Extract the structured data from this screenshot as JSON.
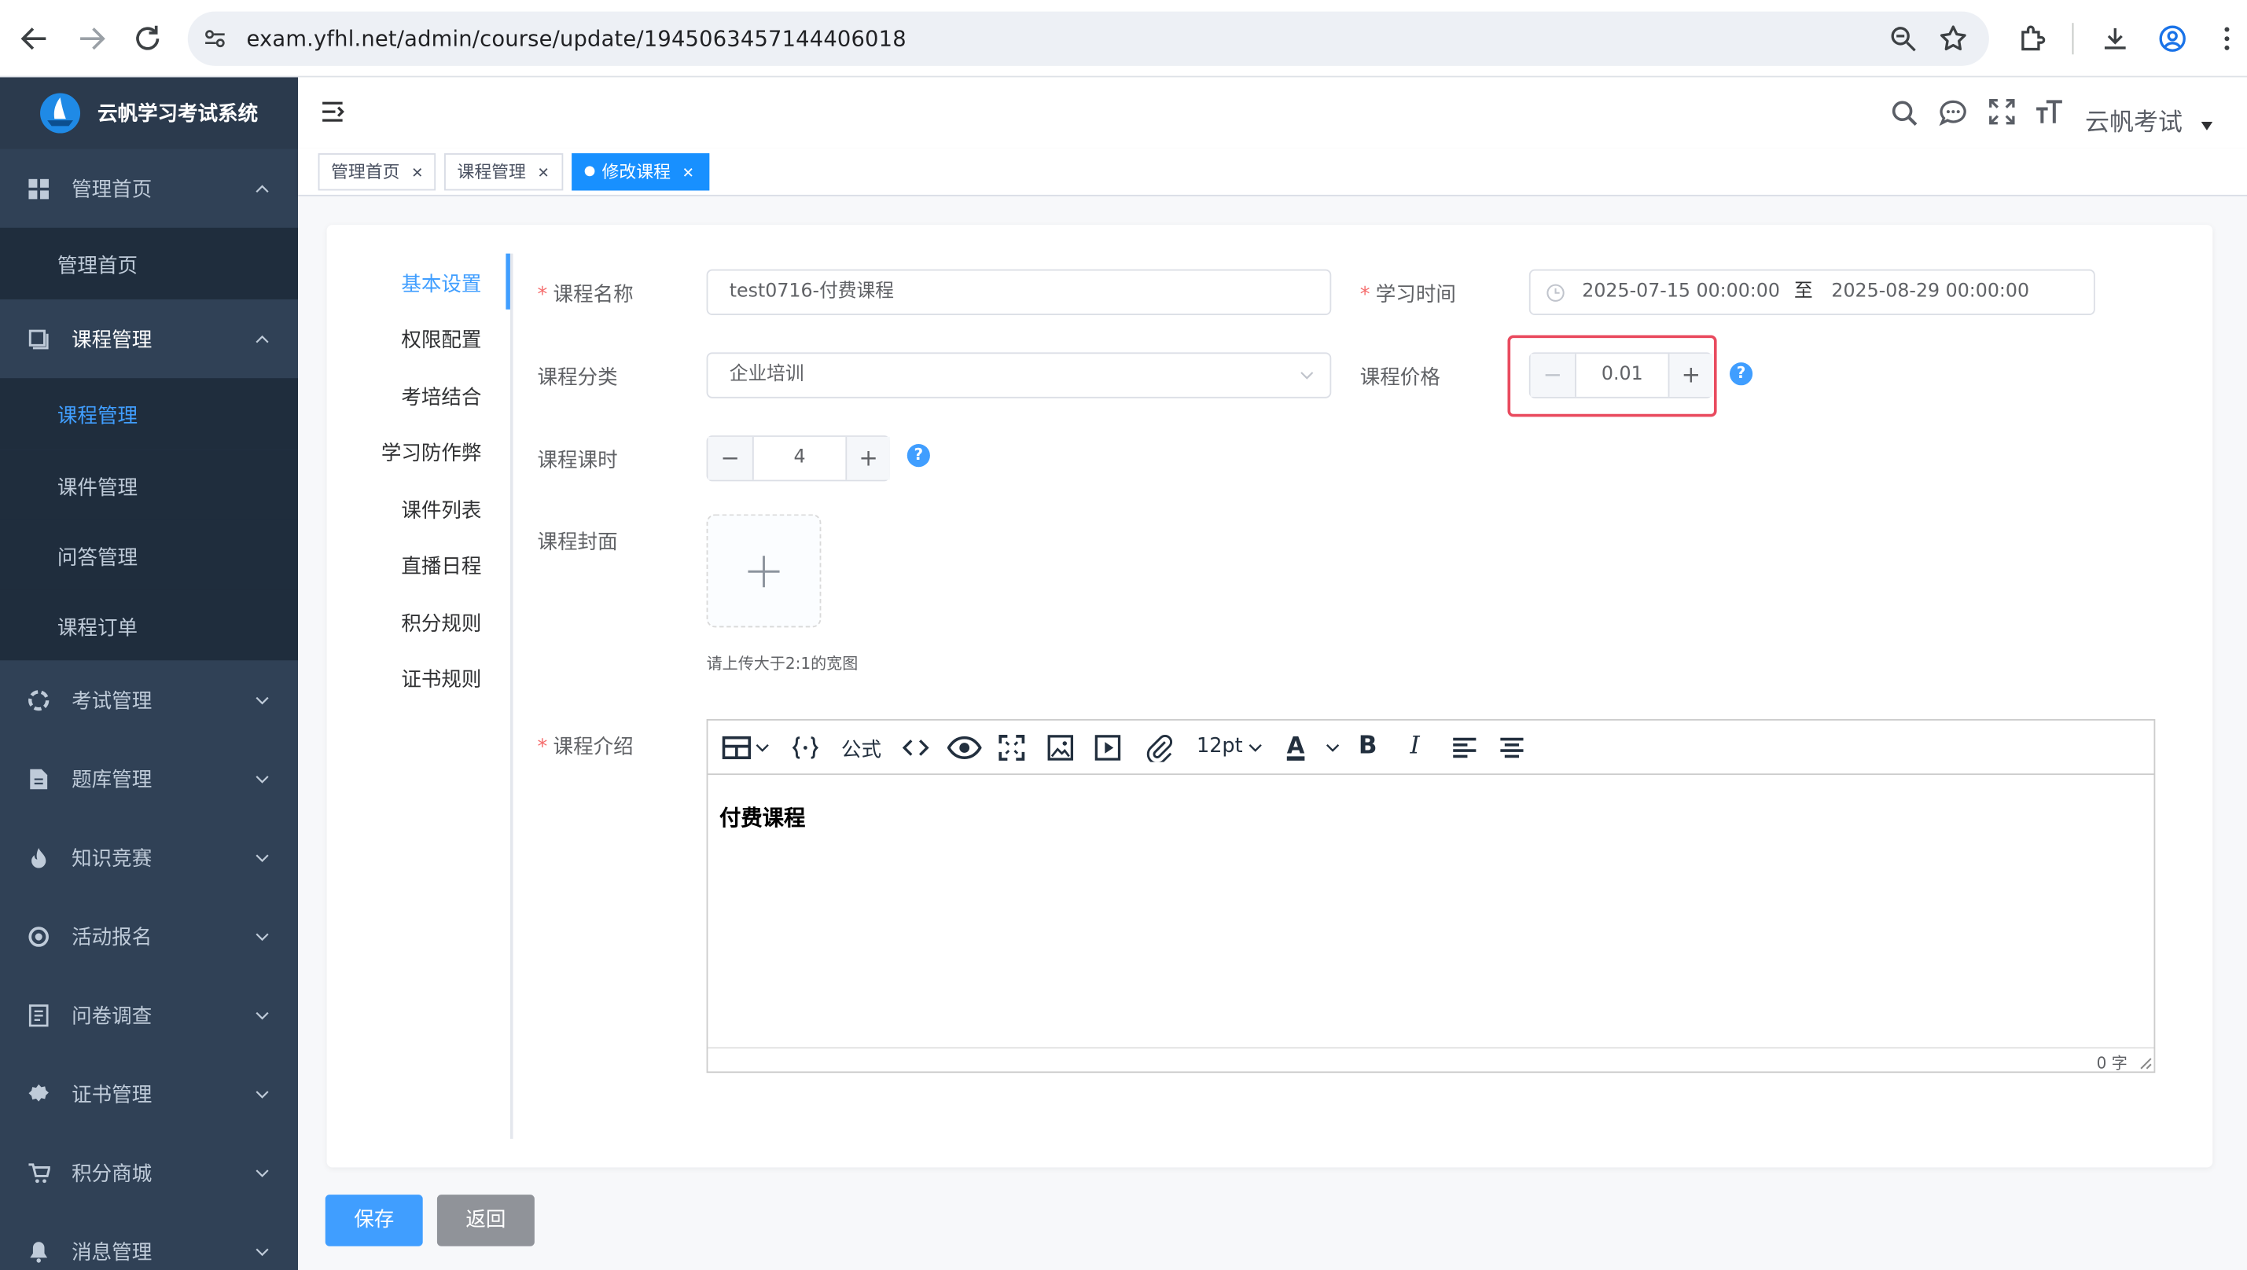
{
  "browser": {
    "url": "exam.yfhl.net/admin/course/update/1945063457144406018"
  },
  "sidebar": {
    "app_title": "云帆学习考试系统",
    "menu": [
      {
        "label": "管理首页",
        "icon": "dashboard-icon",
        "expanded": true
      },
      {
        "label": "课程管理",
        "icon": "book-icon",
        "expanded": true
      },
      {
        "label": "考试管理",
        "icon": "exam-icon",
        "expanded": false
      },
      {
        "label": "题库管理",
        "icon": "document-icon",
        "expanded": false
      },
      {
        "label": "知识竞赛",
        "icon": "fire-icon",
        "expanded": false
      },
      {
        "label": "活动报名",
        "icon": "activity-icon",
        "expanded": false
      },
      {
        "label": "问卷调查",
        "icon": "survey-icon",
        "expanded": false
      },
      {
        "label": "证书管理",
        "icon": "certificate-icon",
        "expanded": false
      },
      {
        "label": "积分商城",
        "icon": "cart-icon",
        "expanded": false
      },
      {
        "label": "消息管理",
        "icon": "bell-icon",
        "expanded": false
      }
    ],
    "home_sub": [
      "管理首页"
    ],
    "course_sub": [
      "课程管理",
      "课件管理",
      "问答管理",
      "课程订单"
    ],
    "active_sub": "课程管理"
  },
  "header": {
    "user_name": "云帆考试"
  },
  "tags": [
    {
      "label": "管理首页",
      "active": false
    },
    {
      "label": "课程管理",
      "active": false
    },
    {
      "label": "修改课程",
      "active": true
    }
  ],
  "form_tabs": [
    "基本设置",
    "权限配置",
    "考培结合",
    "学习防作弊",
    "课件列表",
    "直播日程",
    "积分规则",
    "证书规则"
  ],
  "active_form_tab": "基本设置",
  "form": {
    "course_name_label": "课程名称",
    "course_name_value": "test0716-付费课程",
    "study_time_label": "学习时间",
    "start_time": "2025-07-15 00:00:00",
    "range_sep": "至",
    "end_time": "2025-08-29 00:00:00",
    "category_label": "课程分类",
    "category_value": "企业培训",
    "price_label": "课程价格",
    "price_value": "0.01",
    "hours_label": "课程课时",
    "hours_value": "4",
    "cover_label": "课程封面",
    "cover_hint": "请上传大于2:1的宽图",
    "intro_label": "课程介绍",
    "intro_content": "付费课程",
    "word_count": "0 字",
    "help_mark": "?"
  },
  "editor_toolbar": {
    "formula": "公式",
    "font_size": "12pt",
    "text_color_glyph": "A",
    "bold_glyph": "B",
    "italic_glyph": "I"
  },
  "actions": {
    "save": "保存",
    "back": "返回"
  },
  "colors": {
    "sidebar_bg": "#304156",
    "sidebar_sub_bg": "#1f2d3d",
    "accent": "#409eff",
    "highlight_box": "#e94b5f"
  }
}
